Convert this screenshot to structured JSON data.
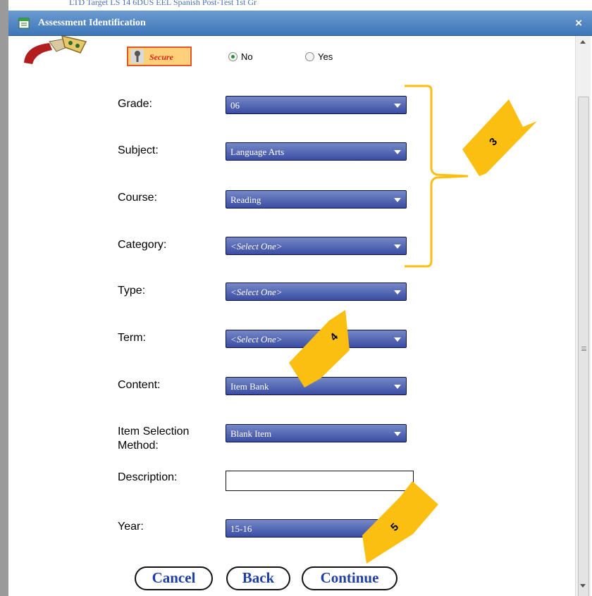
{
  "background_text": "LTD Target LS 14 6DUS EEL Spanish Post-Test 1st Gr",
  "dialog": {
    "title": "Assessment Identification",
    "close_label": "×"
  },
  "secure": {
    "label": "Secure",
    "options": [
      "No",
      "Yes"
    ],
    "selected": "No"
  },
  "fields": {
    "grade": {
      "label": "Grade:",
      "value": "06"
    },
    "subject": {
      "label": "Subject:",
      "value": "Language Arts"
    },
    "course": {
      "label": "Course:",
      "value": "Reading"
    },
    "category": {
      "label": "Category:",
      "value": "<Select One>"
    },
    "type": {
      "label": "Type:",
      "value": "<Select One>"
    },
    "term": {
      "label": "Term:",
      "value": "<Select One>"
    },
    "content": {
      "label": "Content:",
      "value": "Item Bank"
    },
    "item_selection": {
      "label_line1": "Item Selection",
      "label_line2": "Method:",
      "value": "Blank Item"
    },
    "description": {
      "label": "Description:",
      "value": ""
    },
    "year": {
      "label": "Year:",
      "value": "15-16"
    }
  },
  "buttons": {
    "cancel": "Cancel",
    "back": "Back",
    "continue": "Continue"
  },
  "annotations": [
    "3",
    "4",
    "5"
  ],
  "colors": {
    "titlebar": "#3e76b8",
    "select": "#3a4da4",
    "annotation_arrow": "#fbbf11",
    "button_text": "#1f3fa6"
  }
}
